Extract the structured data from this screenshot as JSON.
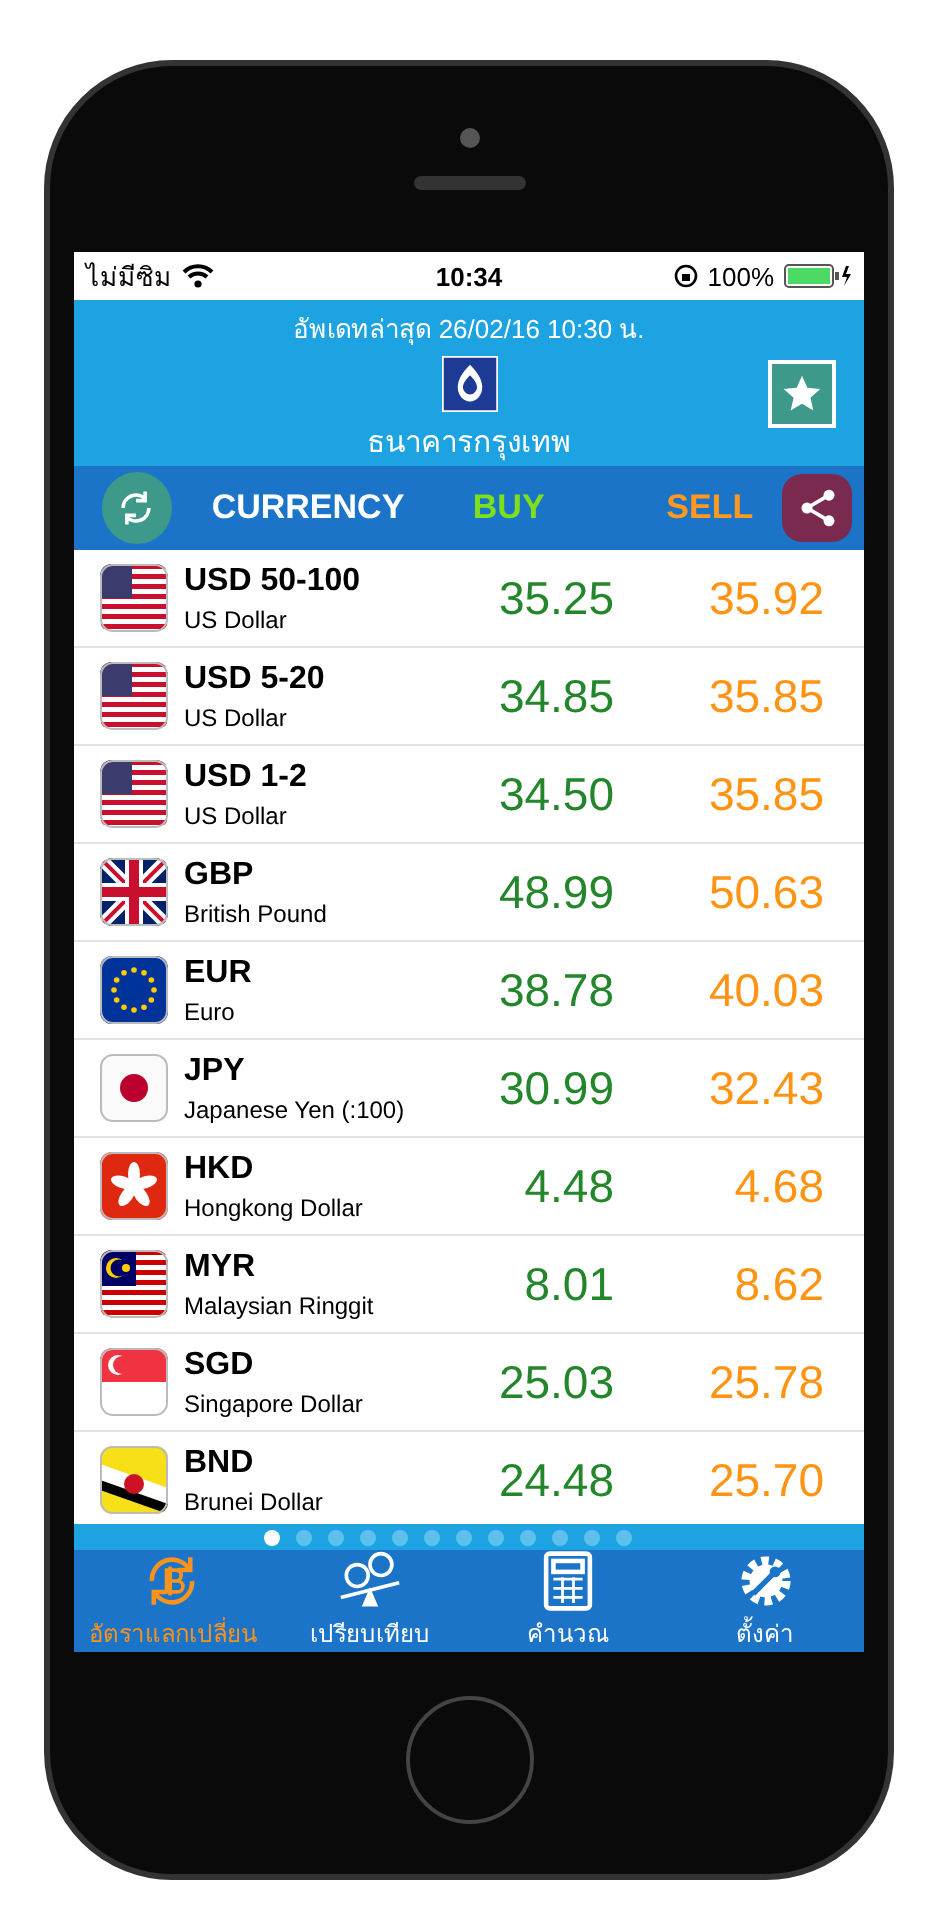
{
  "status_bar": {
    "carrier": "ไม่มีซิม",
    "time": "10:34",
    "battery": "100%"
  },
  "header": {
    "updated": "อัพเดทล่าสุด 26/02/16 10:30 น.",
    "bank": "ธนาคารกรุงเทพ"
  },
  "columns": {
    "currency": "CURRENCY",
    "buy": "BUY",
    "sell": "SELL"
  },
  "rows": [
    {
      "code": "USD 50-100",
      "name": "US Dollar",
      "buy": "35.25",
      "sell": "35.92",
      "kind": "us"
    },
    {
      "code": "USD 5-20",
      "name": "US Dollar",
      "buy": "34.85",
      "sell": "35.85",
      "kind": "us"
    },
    {
      "code": "USD 1-2",
      "name": "US Dollar",
      "buy": "34.50",
      "sell": "35.85",
      "kind": "us"
    },
    {
      "code": "GBP",
      "name": "British Pound",
      "buy": "48.99",
      "sell": "50.63",
      "kind": "gb"
    },
    {
      "code": "EUR",
      "name": "Euro",
      "buy": "38.78",
      "sell": "40.03",
      "kind": "eu"
    },
    {
      "code": "JPY",
      "name": "Japanese Yen (:100)",
      "buy": "30.99",
      "sell": "32.43",
      "kind": "jp"
    },
    {
      "code": "HKD",
      "name": "Hongkong Dollar",
      "buy": "4.48",
      "sell": "4.68",
      "kind": "hk"
    },
    {
      "code": "MYR",
      "name": "Malaysian Ringgit",
      "buy": "8.01",
      "sell": "8.62",
      "kind": "my"
    },
    {
      "code": "SGD",
      "name": "Singapore Dollar",
      "buy": "25.03",
      "sell": "25.78",
      "kind": "sg"
    },
    {
      "code": "BND",
      "name": "Brunei Dollar",
      "buy": "24.48",
      "sell": "25.70",
      "kind": "bn"
    }
  ],
  "pages": [
    {
      "selected": true
    },
    {
      "selected": false
    },
    {
      "selected": false
    },
    {
      "selected": false
    },
    {
      "selected": false
    },
    {
      "selected": false
    },
    {
      "selected": false
    },
    {
      "selected": false
    },
    {
      "selected": false
    },
    {
      "selected": false
    },
    {
      "selected": false
    },
    {
      "selected": false
    }
  ],
  "tabs": [
    {
      "label": "อัตราแลกเปลี่ยน",
      "kind": "rates",
      "selected": true
    },
    {
      "label": "เปรียบเทียบ",
      "kind": "compare",
      "selected": false
    },
    {
      "label": "คำนวณ",
      "kind": "calculator",
      "selected": false
    },
    {
      "label": "ตั้งค่า",
      "kind": "settings",
      "selected": false
    }
  ]
}
